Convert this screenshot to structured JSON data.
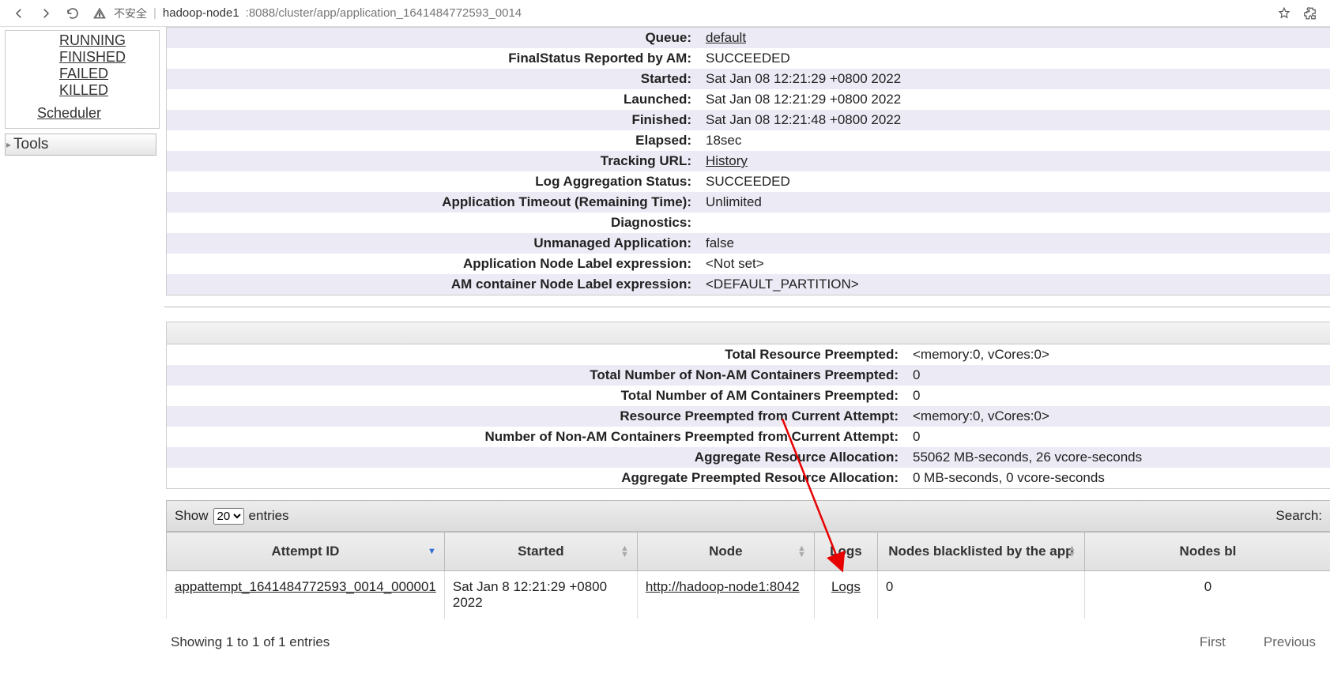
{
  "browser": {
    "security_text": "不安全",
    "url_host": "hadoop-node1",
    "url_port_path": ":8088/cluster/app/application_1641484772593_0014"
  },
  "sidebar": {
    "items": [
      {
        "label": "RUNNING"
      },
      {
        "label": "FINISHED"
      },
      {
        "label": "FAILED"
      },
      {
        "label": "KILLED"
      }
    ],
    "scheduler_label": "Scheduler",
    "tools_label": "Tools"
  },
  "app_info": [
    {
      "key": "Queue:",
      "val": "default",
      "link": true
    },
    {
      "key": "FinalStatus Reported by AM:",
      "val": "SUCCEEDED"
    },
    {
      "key": "Started:",
      "val": "Sat Jan 08 12:21:29 +0800 2022"
    },
    {
      "key": "Launched:",
      "val": "Sat Jan 08 12:21:29 +0800 2022"
    },
    {
      "key": "Finished:",
      "val": "Sat Jan 08 12:21:48 +0800 2022"
    },
    {
      "key": "Elapsed:",
      "val": "18sec"
    },
    {
      "key": "Tracking URL:",
      "val": "History",
      "link": true
    },
    {
      "key": "Log Aggregation Status:",
      "val": "SUCCEEDED"
    },
    {
      "key": "Application Timeout (Remaining Time):",
      "val": "Unlimited"
    },
    {
      "key": "Diagnostics:",
      "val": ""
    },
    {
      "key": "Unmanaged Application:",
      "val": "false"
    },
    {
      "key": "Application Node Label expression:",
      "val": "<Not set>"
    },
    {
      "key": "AM container Node Label expression:",
      "val": "<DEFAULT_PARTITION>"
    }
  ],
  "metrics": [
    {
      "key": "Total Resource Preempted:",
      "val": "<memory:0, vCores:0>"
    },
    {
      "key": "Total Number of Non-AM Containers Preempted:",
      "val": "0"
    },
    {
      "key": "Total Number of AM Containers Preempted:",
      "val": "0"
    },
    {
      "key": "Resource Preempted from Current Attempt:",
      "val": "<memory:0, vCores:0>"
    },
    {
      "key": "Number of Non-AM Containers Preempted from Current Attempt:",
      "val": "0"
    },
    {
      "key": "Aggregate Resource Allocation:",
      "val": "55062 MB-seconds, 26 vcore-seconds"
    },
    {
      "key": "Aggregate Preempted Resource Allocation:",
      "val": "0 MB-seconds, 0 vcore-seconds"
    }
  ],
  "table_ctrl": {
    "show_pre": "Show",
    "show_val": "20",
    "show_post": "entries",
    "search_label": "Search:"
  },
  "table": {
    "headers": [
      "Attempt ID",
      "Started",
      "Node",
      "Logs",
      "Nodes blacklisted by the app",
      "Nodes bl"
    ],
    "row": {
      "attempt_id": "appattempt_1641484772593_0014_000001",
      "started": "Sat Jan 8 12:21:29 +0800 2022",
      "node": "http://hadoop-node1:8042",
      "logs": "Logs",
      "blk_app": "0",
      "blk_other": "0"
    }
  },
  "footer": {
    "info": "Showing 1 to 1 of 1 entries",
    "first": "First",
    "prev": "Previous"
  }
}
